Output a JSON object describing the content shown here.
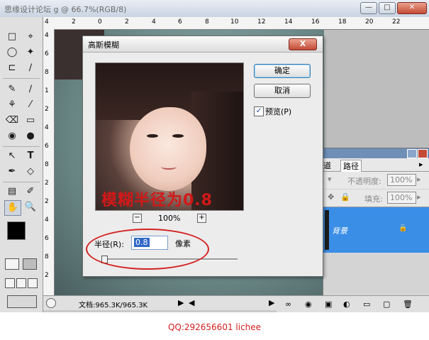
{
  "window": {
    "title": "思缘设计论坛 g @ 66.7%(RGB/8)",
    "controls": {
      "minimize": "—",
      "maximize": "□",
      "close": "✕"
    }
  },
  "rulers": {
    "h_labels": [
      "4",
      "2",
      "0",
      "2",
      "4",
      "6",
      "8",
      "10",
      "12",
      "14",
      "16",
      "18",
      "20",
      "22"
    ],
    "v_labels": [
      "4",
      "6",
      "8",
      "1",
      "2",
      "4",
      "6",
      "8",
      "2",
      "2",
      "4",
      "6",
      "8",
      "2"
    ]
  },
  "toolbox": {
    "tools": [
      "□",
      "⌖",
      "◯",
      "✦",
      "⊏",
      "∕",
      "✎",
      "∕",
      "⚘",
      "⁄",
      "⌫",
      "▭",
      "◉",
      "●",
      "↖",
      "T",
      "✒",
      "◇",
      "▤",
      "✐",
      "✋",
      "🔍"
    ]
  },
  "status": {
    "doc_size": "文档:965.3K/965.3K"
  },
  "layers": {
    "tabs": [
      "道",
      "路径"
    ],
    "opacity_label": "不透明度:",
    "opacity_value": "100%",
    "fill_label": "填充:",
    "fill_value": "100%",
    "layer_name": "背景"
  },
  "dialog": {
    "title": "高斯模糊",
    "close": "X",
    "ok": "确定",
    "cancel": "取消",
    "preview_label": "预览(P)",
    "preview_checked": "✓",
    "zoom_out": "−",
    "zoom_in": "+",
    "zoom_level": "100%",
    "radius_label": "半径(R):",
    "radius_value": "0.8",
    "radius_unit": "像素",
    "overlay_text": "模糊半径为0.8"
  },
  "watermark": "QQ:292656601 lichee",
  "colors": {
    "accent": "#3a8ee6",
    "annotation": "#d32020"
  }
}
